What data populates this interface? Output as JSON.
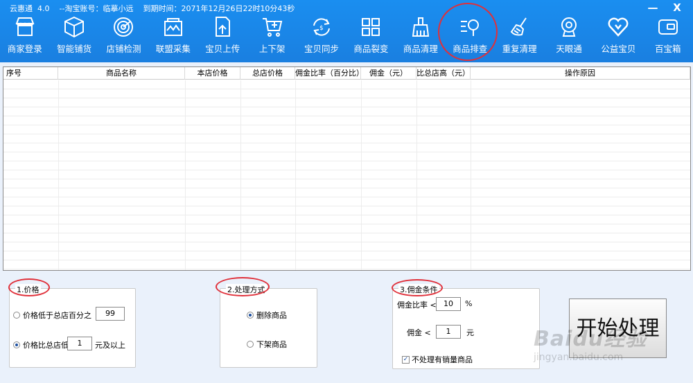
{
  "titlebar": {
    "app_name": "云惠通  4.0",
    "account": "--淘宝账号：临摹小远",
    "expire": "到期时间：2071年12月26日22时10分43秒",
    "minimize": "—",
    "close": "X"
  },
  "toolbar": [
    {
      "label": "商家登录",
      "icon": "shop-icon"
    },
    {
      "label": "智能铺货",
      "icon": "box-icon"
    },
    {
      "label": "店铺检测",
      "icon": "radar-icon"
    },
    {
      "label": "联盟采集",
      "icon": "collect-icon"
    },
    {
      "label": "宝贝上传",
      "icon": "upload-icon"
    },
    {
      "label": "上下架",
      "icon": "cart-icon"
    },
    {
      "label": "宝贝同步",
      "icon": "sync-icon"
    },
    {
      "label": "商品裂变",
      "icon": "grid-icon"
    },
    {
      "label": "商品清理",
      "icon": "brush-icon"
    },
    {
      "label": "商品排查",
      "icon": "search-list-icon"
    },
    {
      "label": "重复清理",
      "icon": "broom-icon"
    },
    {
      "label": "天眼通",
      "icon": "camera-icon"
    },
    {
      "label": "公益宝贝",
      "icon": "heart-icon"
    },
    {
      "label": "百宝箱",
      "icon": "card-icon"
    }
  ],
  "table": {
    "headers": [
      "序号",
      "商品名称",
      "本店价格",
      "总店价格",
      "佣金比率（百分比）",
      "佣金（元）",
      "比总店高（元）",
      "操作原因"
    ]
  },
  "price_group": {
    "title": "1.价格",
    "opt1_label": "价格低于总店百分之",
    "opt1_value": "99",
    "opt2_label": "价格比总店低",
    "opt2_value": "1",
    "opt2_suffix": "元及以上"
  },
  "method_group": {
    "title": "2.处理方式",
    "opt1_label": "删除商品",
    "opt2_label": "下架商品"
  },
  "commission_group": {
    "title": "3.佣金条件",
    "rate_label": "佣金比率 <",
    "rate_value": "10",
    "rate_unit": "%",
    "amount_label": "佣金  <",
    "amount_value": "1",
    "amount_unit": "元",
    "checkbox_label": "不处理有销量商品"
  },
  "start_button": "开始处理",
  "watermark": {
    "main": "Baidu经验",
    "sub": "jingyan.baidu.com"
  }
}
